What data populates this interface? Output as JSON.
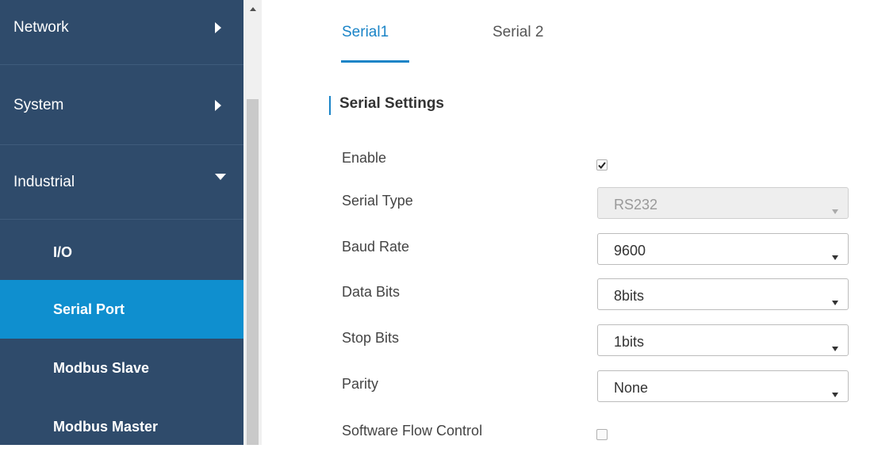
{
  "sidebar": {
    "items": [
      {
        "label": "Network"
      },
      {
        "label": "System"
      },
      {
        "label": "Industrial"
      }
    ],
    "sub_items": [
      {
        "label": "I/O"
      },
      {
        "label": "Serial Port"
      },
      {
        "label": "Modbus Slave"
      },
      {
        "label": "Modbus Master"
      }
    ],
    "active_color": "#0f8fcf",
    "bg_color": "#2f4b6b"
  },
  "tabs": [
    {
      "label": "Serial1"
    },
    {
      "label": "Serial 2"
    }
  ],
  "section": {
    "title": "Serial Settings"
  },
  "form": {
    "enable": {
      "label": "Enable",
      "checked": true
    },
    "serial_type": {
      "label": "Serial Type",
      "value": "RS232",
      "disabled": true
    },
    "baud_rate": {
      "label": "Baud Rate",
      "value": "9600"
    },
    "data_bits": {
      "label": "Data Bits",
      "value": "8bits"
    },
    "stop_bits": {
      "label": "Stop Bits",
      "value": "1bits"
    },
    "parity": {
      "label": "Parity",
      "value": "None"
    },
    "software_flow_control": {
      "label": "Software Flow Control",
      "checked": false
    }
  },
  "accent_color": "#1a84c7"
}
